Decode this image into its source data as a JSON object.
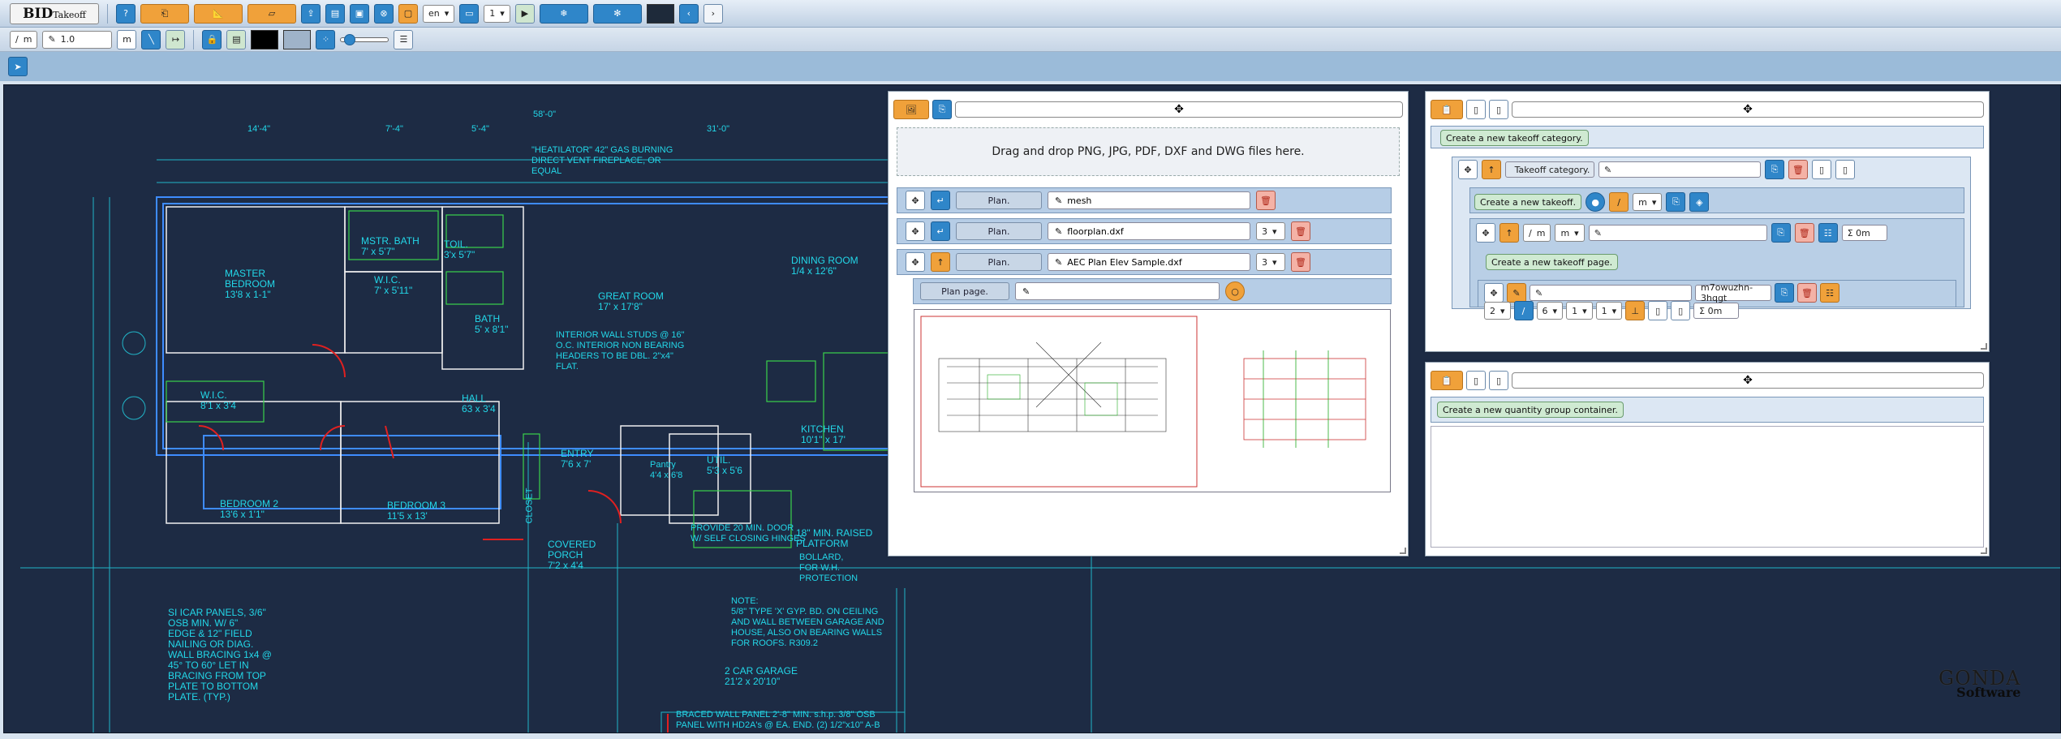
{
  "toolbar": {
    "logo_main": "BID",
    "logo_sub": "Takeoff",
    "help_label": "?",
    "language": "en",
    "page_number": "1",
    "line_width": "1.0",
    "unit": "m"
  },
  "file_panel": {
    "dropzone_text": "Drag and drop PNG, JPG, PDF, DXF and DWG files here.",
    "files": [
      {
        "plan_label": "Plan.",
        "name": "mesh",
        "pages": ""
      },
      {
        "plan_label": "Plan.",
        "name": "floorplan.dxf",
        "pages": "3"
      },
      {
        "plan_label": "Plan.",
        "name": "AEC Plan Elev Sample.dxf",
        "pages": "3"
      }
    ],
    "plan_page_label": "Plan page."
  },
  "takeoff_panel": {
    "create_category": "Create a new takeoff category.",
    "category_label": "Takeoff category.",
    "create_takeoff": "Create a new takeoff.",
    "unit_m": "m",
    "create_page": "Create a new takeoff page.",
    "total": "Σ 0m",
    "page_id": "m7owuzhn-3hqgt",
    "page_sel_a": "2",
    "page_sel_b": "6",
    "page_sel_c": "1",
    "page_sel_d": "1"
  },
  "quantity_panel": {
    "create_group": "Create a new quantity group container."
  },
  "cad_labels": [
    {
      "id": "dim-top",
      "text": "58'-0\""
    },
    {
      "id": "dim-14-4",
      "text": "14'-4\""
    },
    {
      "id": "dim-7-4",
      "text": "7'-4\""
    },
    {
      "id": "dim-5-4",
      "text": "5'-4\""
    },
    {
      "id": "dim-31-0",
      "text": "31'-0\""
    },
    {
      "id": "heatilator",
      "text": "\"HEATILATOR\" 42\" GAS BURNING\nDIRECT VENT FIREPLACE, OR\nEQUAL"
    },
    {
      "id": "master",
      "text": "MASTER\nBEDROOM\n13'8 x 1-1\""
    },
    {
      "id": "mstr-bath",
      "text": "MSTR. BATH\n7' x 5'7\""
    },
    {
      "id": "toil",
      "text": "TOIL.\n3'x 5'7\""
    },
    {
      "id": "wic1",
      "text": "W.I.C.\n7' x 5'11\""
    },
    {
      "id": "bath",
      "text": "BATH\n5' x 8'1\""
    },
    {
      "id": "great",
      "text": "GREAT ROOM\n17' x 17'8\""
    },
    {
      "id": "dining",
      "text": "DINING ROOM\n1/4 x 12'6\""
    },
    {
      "id": "interior",
      "text": "INTERIOR WALL STUDS @ 16\"\nO.C. INTERIOR NON BEARING\nHEADERS TO BE DBL. 2\"x4\"\nFLAT."
    },
    {
      "id": "wic2",
      "text": "W.I.C.\n8'1 x 3'4"
    },
    {
      "id": "hall",
      "text": "HALL\n63 x 3'4"
    },
    {
      "id": "kitchen",
      "text": "KITCHEN\n10'1\" x 17'"
    },
    {
      "id": "entry",
      "text": "ENTRY\n7'6 x 7'"
    },
    {
      "id": "pantry",
      "text": "Pantry\n4'4 x 6'8"
    },
    {
      "id": "util",
      "text": "UTIL.\n5'3 x 5'6"
    },
    {
      "id": "bed2",
      "text": "BEDROOM 2\n13'6 x 1'1\""
    },
    {
      "id": "bed3",
      "text": "BEDROOM 3\n11'5 x 13'"
    },
    {
      "id": "covered",
      "text": "COVERED\nPORCH\n7'2 x 4'4"
    },
    {
      "id": "provide",
      "text": "PROVIDE 20 MIN. DOOR\nW/ SELF CLOSING HINGES"
    },
    {
      "id": "raised",
      "text": "18\" MIN. RAISED\nPLATFORM"
    },
    {
      "id": "bollard",
      "text": "BOLLARD,\nFOR W.H.\nPROTECTION"
    },
    {
      "id": "note",
      "text": "NOTE:\n5/8\" TYPE 'X' GYP. BD. ON CEILING\nAND WALL BETWEEN GARAGE AND\nHOUSE, ALSO ON BEARING WALLS\nFOR ROOFS. R309.2"
    },
    {
      "id": "garage",
      "text": "2 CAR GARAGE\n21'2 x 20'10\""
    },
    {
      "id": "braced",
      "text": "BRACED WALL PANEL 2'-8\" MIN. s.h.p. 3/8\" OSB\nPANEL WITH HD2A's @ EA. END. (2) 1/2\"x10\" A-B"
    },
    {
      "id": "panels",
      "text": "SI ICAR PANELS, 3/6\"\nOSB MIN. W/ 6\"\nEDGE & 12\" FIELD\nNAILING OR DIAG.\nWALL BRACING 1x4 @\n45° TO 60° LET IN\nBRACING FROM TOP\nPLATE TO BOTTOM\nPLATE. (TYP.)"
    },
    {
      "id": "closet",
      "text": "CLOSET"
    }
  ],
  "brand": {
    "line1": "GONDA",
    "line2": "Software"
  },
  "colors": {
    "cad_bg": "#1d2b44",
    "cad_line": "#23d7e8",
    "wall": "#3e8cff",
    "accent_orange": "#f0a13a",
    "accent_blue": "#2f86c9"
  }
}
